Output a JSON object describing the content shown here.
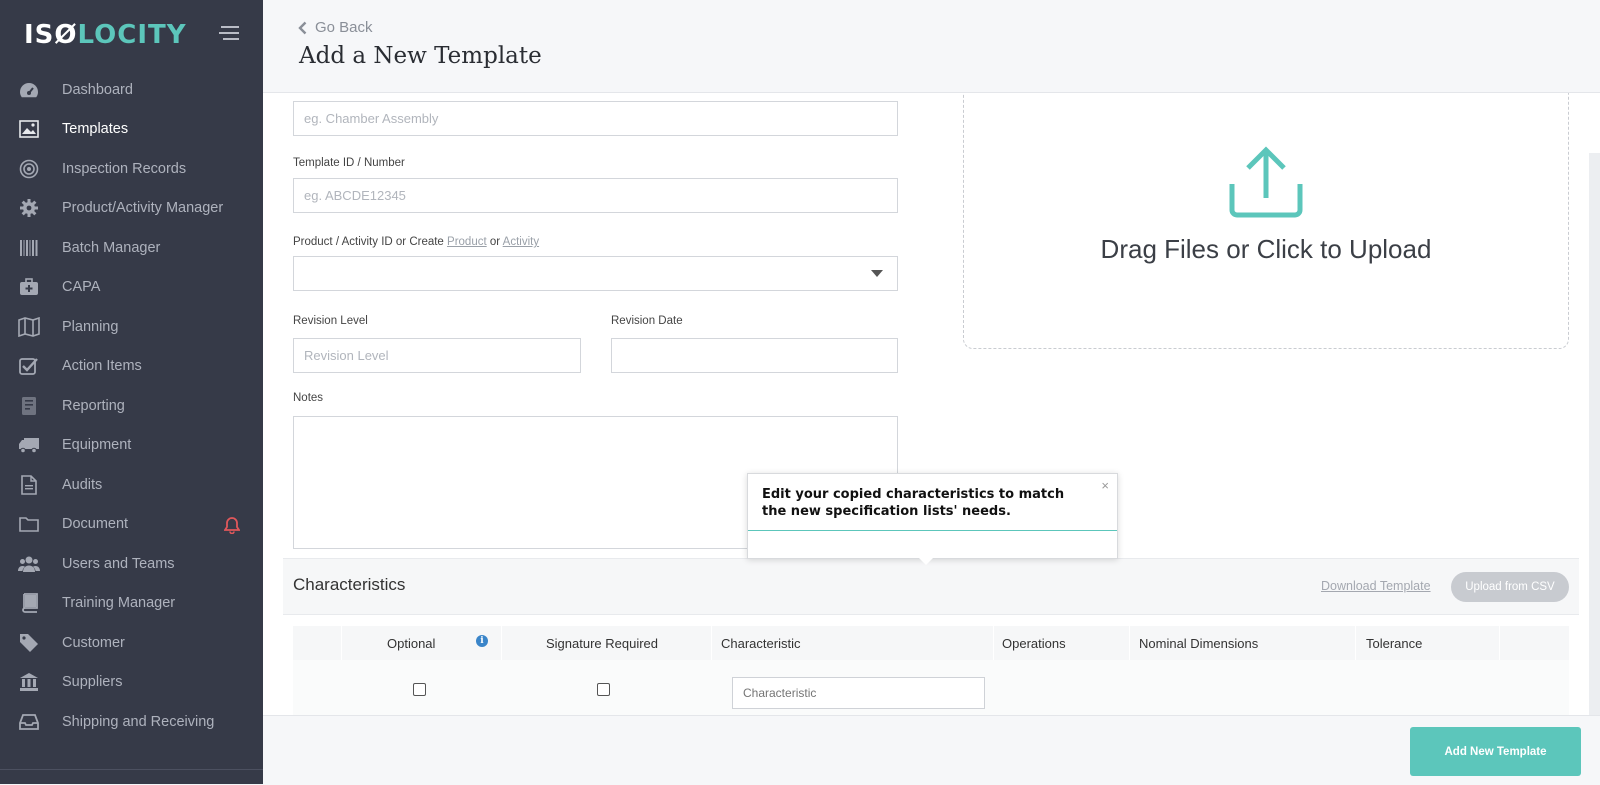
{
  "brand": {
    "logo_left": "ISØ",
    "logo_right": "LOCITY"
  },
  "sidebar": {
    "items": [
      {
        "label": "Dashboard",
        "icon": "dashboard-icon"
      },
      {
        "label": "Templates",
        "icon": "image-icon",
        "active": true
      },
      {
        "label": "Inspection Records",
        "icon": "target-icon"
      },
      {
        "label": "Product/Activity Manager",
        "icon": "gear-icon"
      },
      {
        "label": "Batch Manager",
        "icon": "barcode-icon"
      },
      {
        "label": "CAPA",
        "icon": "medkit-icon"
      },
      {
        "label": "Planning",
        "icon": "map-icon"
      },
      {
        "label": "Action Items",
        "icon": "checkbox-icon"
      },
      {
        "label": "Reporting",
        "icon": "report-icon"
      },
      {
        "label": "Equipment",
        "icon": "truck-icon"
      },
      {
        "label": "Audits",
        "icon": "file-icon"
      },
      {
        "label": "Document",
        "icon": "folder-icon"
      },
      {
        "label": "Users and Teams",
        "icon": "users-icon"
      },
      {
        "label": "Training Manager",
        "icon": "book-icon"
      },
      {
        "label": "Customer",
        "icon": "tag-icon"
      },
      {
        "label": "Suppliers",
        "icon": "supplier-icon"
      },
      {
        "label": "Shipping and Receiving",
        "icon": "inbox-icon"
      }
    ]
  },
  "header": {
    "go_back": "Go Back",
    "title": "Add a New Template"
  },
  "form": {
    "name_placeholder": "eg. Chamber Assembly",
    "template_id_label": "Template ID / Number",
    "template_id_placeholder": "eg. ABCDE12345",
    "product_label_prefix": "Product / Activity ID or Create ",
    "product_link": "Product",
    "product_label_or": " or ",
    "activity_link": "Activity",
    "revision_level_label": "Revision Level",
    "revision_level_placeholder": "Revision Level",
    "revision_date_label": "Revision Date",
    "notes_label": "Notes"
  },
  "upload": {
    "text": "Drag Files or Click to Upload"
  },
  "tooltip": {
    "text": "Edit your copied characteristics to match the new specification lists' needs.",
    "close": "×"
  },
  "characteristics": {
    "title": "Characteristics",
    "download_template": "Download Template",
    "upload_csv": "Upload from CSV",
    "columns": {
      "optional": "Optional",
      "signature": "Signature Required",
      "characteristic": "Characteristic",
      "operations": "Operations",
      "nominal": "Nominal Dimensions",
      "tolerance": "Tolerance"
    },
    "row_placeholder": "Characteristic"
  },
  "footer": {
    "add_button": "Add New Template"
  },
  "colors": {
    "accent": "#5cc6bb",
    "sidebar": "#363a48",
    "alert": "#e0575b"
  }
}
